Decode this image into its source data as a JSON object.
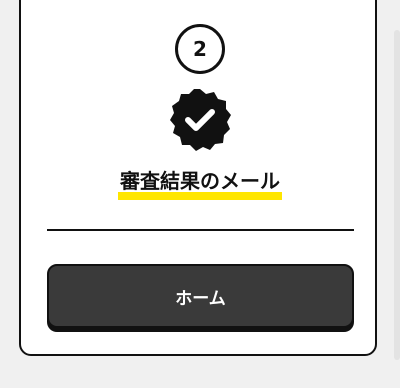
{
  "step": {
    "number": "2"
  },
  "status": {
    "icon": "verified-check-icon"
  },
  "title": {
    "text": "審査結果のメール",
    "highlight_color": "#ffe600"
  },
  "actions": {
    "home_label": "ホーム"
  }
}
